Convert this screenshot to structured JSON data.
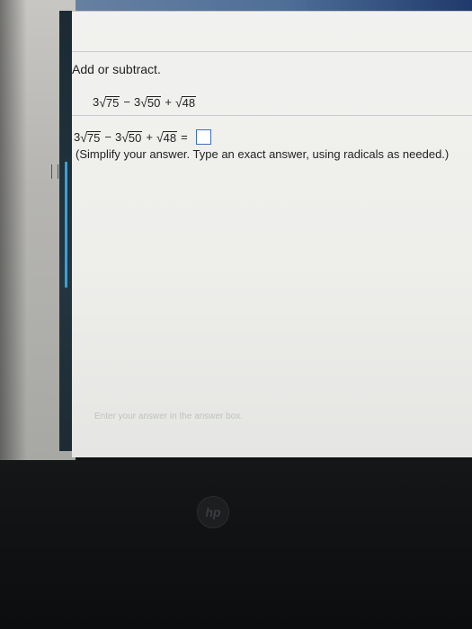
{
  "question": {
    "instruction": "Add or subtract.",
    "expression": {
      "c1": "3",
      "r1": "75",
      "op1": "−",
      "c2": "3",
      "r2": "50",
      "op2": "+",
      "r3": "48"
    },
    "answer_equals": "=",
    "answer_value": "",
    "note": "(Simplify your answer. Type an exact answer, using radicals as needed.)"
  },
  "footer": {
    "hint": "Enter your answer in the answer box."
  },
  "device": {
    "logo": "hp"
  },
  "colors": {
    "accent": "#3b6fb7",
    "rail_accent": "#3b9fd5"
  }
}
